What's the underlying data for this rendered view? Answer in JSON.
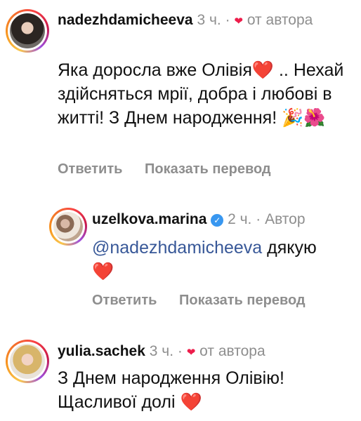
{
  "comments": [
    {
      "username": "nadezhdamicheeva",
      "time": "3 ч.",
      "dot": "·",
      "liked_icon": "heart-icon",
      "by_author": "от автора",
      "text": "Яка доросла вже Олівія",
      "heart_emoji": "❤️",
      "text2": " .. Нехай здійсняться мрії, добра і любові  в житті! З Днем народження!",
      "party_emoji": "🎉",
      "flower_emoji": "🌺",
      "reply_label": "Ответить",
      "translate_label": "Показать перевод"
    },
    {
      "username": "uzelkova.marina",
      "verified_icon": "verified-icon",
      "time": "2 ч.",
      "dot": "·",
      "author": "Автор",
      "mention": "@nadezhdamicheeva",
      "text": " дякую",
      "heart_emoji": "❤️",
      "reply_label": "Ответить",
      "translate_label": "Показать перевод"
    },
    {
      "username": "yulia.sachek",
      "time": "3 ч.",
      "dot": "·",
      "liked_icon": "heart-icon",
      "by_author": "от автора",
      "text": "З Днем народження Олівію! Щасливої долі ",
      "heart_emoji": "❤️"
    }
  ]
}
